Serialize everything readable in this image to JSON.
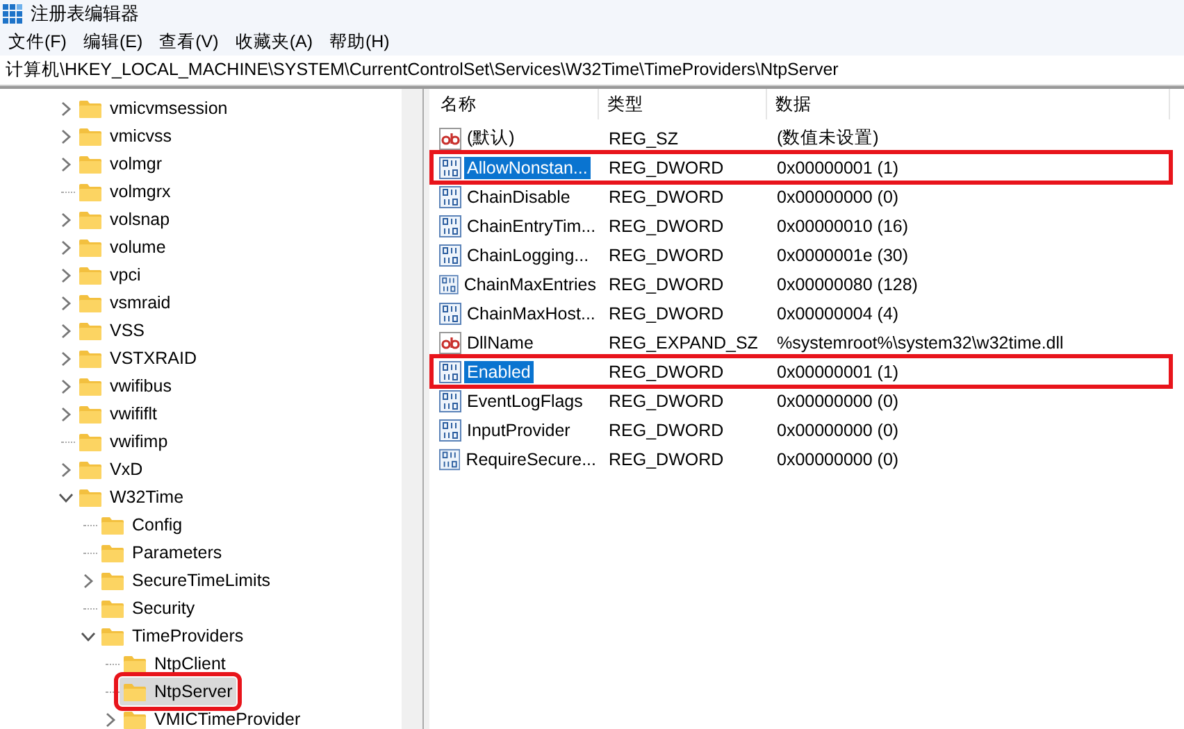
{
  "window": {
    "title": "注册表编辑器"
  },
  "menu": [
    "文件(F)",
    "编辑(E)",
    "查看(V)",
    "收藏夹(A)",
    "帮助(H)"
  ],
  "address": "计算机\\HKEY_LOCAL_MACHINE\\SYSTEM\\CurrentControlSet\\Services\\W32Time\\TimeProviders\\NtpServer",
  "tree": [
    {
      "label": "vmicvmsession",
      "kind": "branch",
      "expanded": false,
      "selected": false,
      "annotated": false
    },
    {
      "label": "vmicvss",
      "kind": "branch",
      "expanded": false,
      "selected": false,
      "annotated": false
    },
    {
      "label": "volmgr",
      "kind": "branch",
      "expanded": false,
      "selected": false,
      "annotated": false
    },
    {
      "label": "volmgrx",
      "kind": "leaf",
      "selected": false,
      "annotated": false
    },
    {
      "label": "volsnap",
      "kind": "branch",
      "expanded": false,
      "selected": false,
      "annotated": false
    },
    {
      "label": "volume",
      "kind": "branch",
      "expanded": false,
      "selected": false,
      "annotated": false
    },
    {
      "label": "vpci",
      "kind": "branch",
      "expanded": false,
      "selected": false,
      "annotated": false
    },
    {
      "label": "vsmraid",
      "kind": "branch",
      "expanded": false,
      "selected": false,
      "annotated": false
    },
    {
      "label": "VSS",
      "kind": "branch",
      "expanded": false,
      "selected": false,
      "annotated": false
    },
    {
      "label": "VSTXRAID",
      "kind": "branch",
      "expanded": false,
      "selected": false,
      "annotated": false
    },
    {
      "label": "vwifibus",
      "kind": "branch",
      "expanded": false,
      "selected": false,
      "annotated": false
    },
    {
      "label": "vwififlt",
      "kind": "branch",
      "expanded": false,
      "selected": false,
      "annotated": false
    },
    {
      "label": "vwifimp",
      "kind": "leaf",
      "selected": false,
      "annotated": false
    },
    {
      "label": "VxD",
      "kind": "branch",
      "expanded": false,
      "selected": false,
      "annotated": false
    },
    {
      "label": "W32Time",
      "kind": "branch",
      "expanded": true,
      "selected": false,
      "annotated": false,
      "children": [
        {
          "label": "Config",
          "kind": "leaf",
          "selected": false,
          "annotated": false
        },
        {
          "label": "Parameters",
          "kind": "leaf",
          "selected": false,
          "annotated": false
        },
        {
          "label": "SecureTimeLimits",
          "kind": "branch",
          "expanded": false,
          "selected": false,
          "annotated": false
        },
        {
          "label": "Security",
          "kind": "leaf",
          "selected": false,
          "annotated": false
        },
        {
          "label": "TimeProviders",
          "kind": "branch",
          "expanded": true,
          "selected": false,
          "annotated": false,
          "children": [
            {
              "label": "NtpClient",
              "kind": "leaf",
              "selected": false,
              "annotated": false
            },
            {
              "label": "NtpServer",
              "kind": "leaf",
              "selected": true,
              "annotated": true
            },
            {
              "label": "VMICTimeProvider",
              "kind": "branch",
              "expanded": false,
              "selected": false,
              "annotated": false
            }
          ]
        }
      ]
    }
  ],
  "values": {
    "columns": [
      "名称",
      "类型",
      "数据"
    ],
    "rows": [
      {
        "kind": "string",
        "name": "(默认)",
        "type": "REG_SZ",
        "data": "(数值未设置)",
        "selected": false,
        "annotated": false
      },
      {
        "kind": "binary",
        "name": "AllowNonstan...",
        "type": "REG_DWORD",
        "data": "0x00000001 (1)",
        "selected": true,
        "annotated": true
      },
      {
        "kind": "binary",
        "name": "ChainDisable",
        "type": "REG_DWORD",
        "data": "0x00000000 (0)",
        "selected": false,
        "annotated": false
      },
      {
        "kind": "binary",
        "name": "ChainEntryTim...",
        "type": "REG_DWORD",
        "data": "0x00000010 (16)",
        "selected": false,
        "annotated": false
      },
      {
        "kind": "binary",
        "name": "ChainLogging...",
        "type": "REG_DWORD",
        "data": "0x0000001e (30)",
        "selected": false,
        "annotated": false
      },
      {
        "kind": "binary",
        "name": "ChainMaxEntries",
        "type": "REG_DWORD",
        "data": "0x00000080 (128)",
        "selected": false,
        "annotated": false
      },
      {
        "kind": "binary",
        "name": "ChainMaxHost...",
        "type": "REG_DWORD",
        "data": "0x00000004 (4)",
        "selected": false,
        "annotated": false
      },
      {
        "kind": "string",
        "name": "DllName",
        "type": "REG_EXPAND_SZ",
        "data": "%systemroot%\\system32\\w32time.dll",
        "selected": false,
        "annotated": false
      },
      {
        "kind": "binary",
        "name": "Enabled",
        "type": "REG_DWORD",
        "data": "0x00000001 (1)",
        "selected": true,
        "annotated": true
      },
      {
        "kind": "binary",
        "name": "EventLogFlags",
        "type": "REG_DWORD",
        "data": "0x00000000 (0)",
        "selected": false,
        "annotated": false
      },
      {
        "kind": "binary",
        "name": "InputProvider",
        "type": "REG_DWORD",
        "data": "0x00000000 (0)",
        "selected": false,
        "annotated": false
      },
      {
        "kind": "binary",
        "name": "RequireSecure...",
        "type": "REG_DWORD",
        "data": "0x00000000 (0)",
        "selected": false,
        "annotated": false
      }
    ]
  }
}
